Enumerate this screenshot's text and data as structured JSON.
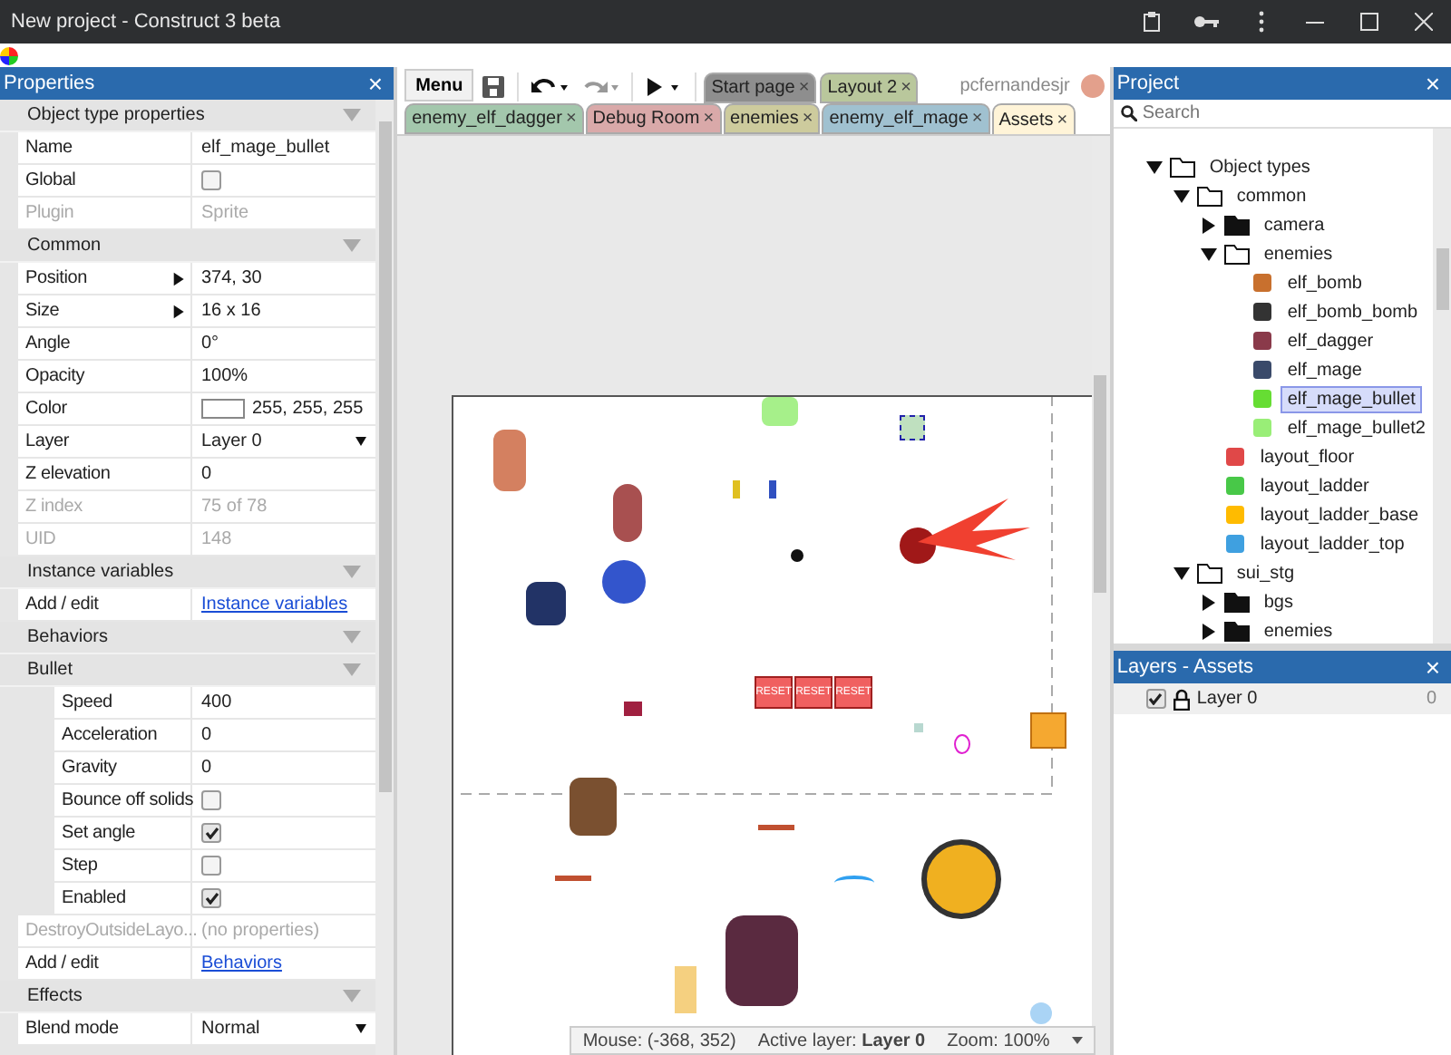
{
  "window": {
    "title": "New project - Construct 3 beta"
  },
  "properties": {
    "title": "Properties",
    "sections": [
      {
        "label": "Object type properties",
        "rows": [
          {
            "kind": "text",
            "label": "Name",
            "value": "elf_mage_bullet",
            "disabled": false
          },
          {
            "kind": "checkbox",
            "label": "Global",
            "checked": false,
            "disabled": false
          },
          {
            "kind": "text",
            "label": "Plugin",
            "value": "Sprite",
            "disabled": true
          }
        ]
      },
      {
        "label": "Common",
        "rows": [
          {
            "kind": "expand",
            "label": "Position",
            "value": "374, 30",
            "disabled": false
          },
          {
            "kind": "expand",
            "label": "Size",
            "value": "16 x 16",
            "disabled": false
          },
          {
            "kind": "text",
            "label": "Angle",
            "value": "0°",
            "disabled": false
          },
          {
            "kind": "text",
            "label": "Opacity",
            "value": "100%",
            "disabled": false
          },
          {
            "kind": "color",
            "label": "Color",
            "value": "255, 255, 255",
            "color": "#ffffff",
            "disabled": false
          },
          {
            "kind": "dropdown",
            "label": "Layer",
            "value": "Layer 0",
            "disabled": false
          },
          {
            "kind": "text",
            "label": "Z elevation",
            "value": "0",
            "disabled": false
          },
          {
            "kind": "text",
            "label": "Z index",
            "value": "75 of 78",
            "disabled": true
          },
          {
            "kind": "text",
            "label": "UID",
            "value": "148",
            "disabled": true
          }
        ]
      },
      {
        "label": "Instance variables",
        "rows": [
          {
            "kind": "link",
            "label": "Add / edit",
            "value": "Instance variables",
            "disabled": false
          }
        ]
      },
      {
        "label": "Behaviors",
        "rows": [
          {
            "kind": "section",
            "label": "Bullet",
            "rows": [
              {
                "kind": "text",
                "label": "Speed",
                "value": "400",
                "disabled": false
              },
              {
                "kind": "text",
                "label": "Acceleration",
                "value": "0",
                "disabled": false
              },
              {
                "kind": "text",
                "label": "Gravity",
                "value": "0",
                "disabled": false
              },
              {
                "kind": "checkbox",
                "label": "Bounce off solids",
                "checked": false,
                "disabled": false
              },
              {
                "kind": "checkbox",
                "label": "Set angle",
                "checked": true,
                "disabled": false
              },
              {
                "kind": "checkbox",
                "label": "Step",
                "checked": false,
                "disabled": false
              },
              {
                "kind": "checkbox",
                "label": "Enabled",
                "checked": true,
                "disabled": false
              }
            ]
          },
          {
            "kind": "text",
            "label": "DestroyOutsideLayo...",
            "value": "(no properties)",
            "disabled": true
          },
          {
            "kind": "link",
            "label": "Add / edit",
            "value": "Behaviors",
            "disabled": false
          }
        ]
      },
      {
        "label": "Effects",
        "rows": [
          {
            "kind": "dropdown",
            "label": "Blend mode",
            "value": "Normal",
            "disabled": false
          }
        ]
      }
    ]
  },
  "toolbar": {
    "menu": "Menu"
  },
  "tabs_top": [
    {
      "label": "Start page",
      "close": "×",
      "color": "#8e8e8e",
      "selected": false
    },
    {
      "label": "Layout 2",
      "close": "×",
      "color": "#b9c79c",
      "selected": false
    }
  ],
  "user": {
    "name": "pcfernandesjr"
  },
  "tabs": [
    {
      "label": "enemy_elf_dagger",
      "close": "×",
      "color": "#a3c7ac",
      "selected": false
    },
    {
      "label": "Debug Room",
      "close": "×",
      "color": "#d9a9a9",
      "selected": false
    },
    {
      "label": "enemies",
      "close": "×",
      "color": "#cdcb9d",
      "selected": false
    },
    {
      "label": "enemy_elf_mage",
      "close": "×",
      "color": "#a0c1d0",
      "selected": false
    },
    {
      "label": "Assets",
      "close": "×",
      "color": "#fff4d8",
      "selected": true
    }
  ],
  "layout": {
    "reset_blocks": [
      "RESET",
      "RESET",
      "RESET"
    ]
  },
  "status_bar": {
    "mouse": "Mouse: (-368, 352)",
    "active_layer": "Active layer: **Layer 0**",
    "zoom": "Zoom: 100%"
  },
  "project": {
    "title": "Project",
    "close": "×",
    "search": {
      "placeholder": "Search"
    },
    "tree": [
      {
        "kind": "folder",
        "label": "Object types",
        "expanded": true,
        "selected": false,
        "children": [
          {
            "kind": "folder",
            "label": "common",
            "expanded": true,
            "selected": false,
            "children": [
              {
                "kind": "folder",
                "label": "camera",
                "expanded": false,
                "selected": false
              },
              {
                "kind": "folder",
                "label": "enemies",
                "expanded": true,
                "selected": false,
                "children": [
                  {
                    "kind": "sprite",
                    "label": "elf_bomb",
                    "color": "#c8702e",
                    "selected": false
                  },
                  {
                    "kind": "sprite",
                    "label": "elf_bomb_bomb",
                    "color": "#333333",
                    "selected": false
                  },
                  {
                    "kind": "sprite",
                    "label": "elf_dagger",
                    "color": "#8a3a4a",
                    "selected": false
                  },
                  {
                    "kind": "sprite",
                    "label": "elf_mage",
                    "color": "#3a4a6a",
                    "selected": false
                  },
                  {
                    "kind": "sprite",
                    "label": "elf_mage_bullet",
                    "color": "#66dd33",
                    "selected": true
                  },
                  {
                    "kind": "sprite",
                    "label": "elf_mage_bullet2",
                    "color": "#99ee77",
                    "selected": false
                  }
                ]
              },
              {
                "kind": "sprite",
                "label": "layout_floor",
                "color": "#e04848",
                "selected": false
              },
              {
                "kind": "sprite",
                "label": "layout_ladder",
                "color": "#48c848",
                "selected": false
              },
              {
                "kind": "sprite",
                "label": "layout_ladder_base",
                "color": "#ffbb00",
                "selected": false
              },
              {
                "kind": "sprite",
                "label": "layout_ladder_top",
                "color": "#3fa0e0",
                "selected": false
              }
            ]
          },
          {
            "kind": "folder",
            "label": "sui_stg",
            "expanded": true,
            "selected": false,
            "children": [
              {
                "kind": "folder",
                "label": "bgs",
                "expanded": false,
                "selected": false
              },
              {
                "kind": "folder",
                "label": "enemies",
                "expanded": false,
                "selected": false
              }
            ]
          }
        ]
      }
    ]
  },
  "layers": {
    "title": "Layers - Assets",
    "close": "×",
    "items": [
      {
        "label": "Layer 0",
        "count": "0",
        "visible": true,
        "locked": true
      }
    ]
  },
  "properties_close": "×"
}
